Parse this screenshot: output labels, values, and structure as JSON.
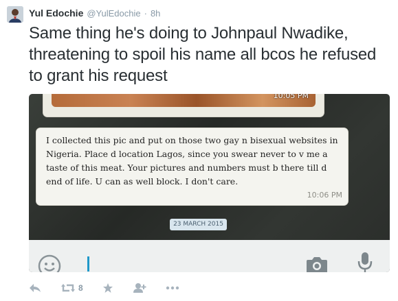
{
  "tweet": {
    "display_name": "Yul Edochie",
    "handle": "@YulEdochie",
    "separator": "·",
    "time": "8h",
    "text": "Same thing he's doing to Johnpaul Nwadike, threatening to spoil his name all bcos he refused to grant his request"
  },
  "media": {
    "photo_time": "10:05 PM",
    "message": "I collected this pic and put on those two gay n bisexual websites in Nigeria. Place d location Lagos, since you swear never to v me a taste of this meat. Your pictures and numbers must b there till d end of life. U can as well block. I don't care.",
    "message_time": "10:06 PM",
    "date_chip": "23 MARCH 2015"
  },
  "actions": {
    "retweet_count": "8"
  },
  "colors": {
    "name": "#292f33",
    "meta": "#8899a6",
    "cursor": "#1f98c9"
  },
  "icons": [
    "avatar",
    "emoji-icon",
    "camera-icon",
    "mic-icon",
    "reply-icon",
    "retweet-icon",
    "favorite-icon",
    "follow-icon",
    "more-icon"
  ]
}
